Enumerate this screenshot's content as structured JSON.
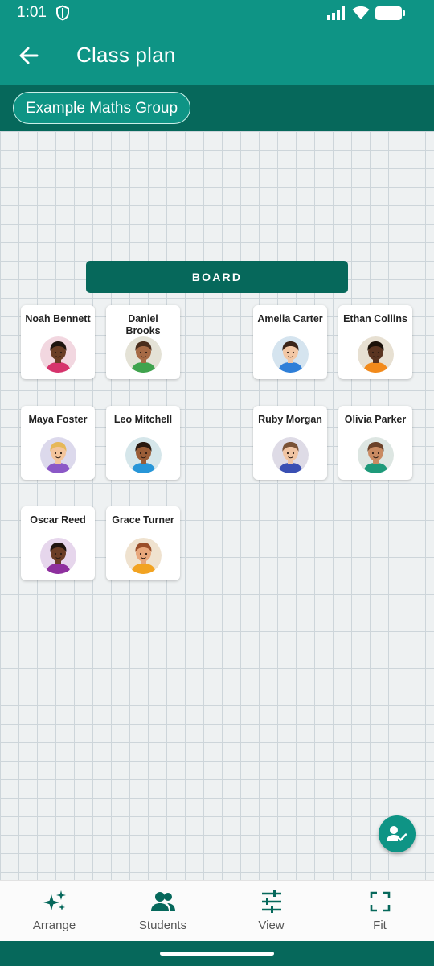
{
  "status": {
    "time": "1:01"
  },
  "header": {
    "title": "Class plan"
  },
  "group": {
    "chip_label": "Example Maths Group"
  },
  "board": {
    "label": "BOARD"
  },
  "students": [
    {
      "name": "Noah Bennett",
      "skin": "#6b3e26",
      "hair": "#1f1510",
      "shirt": "#d6336c",
      "bg": "#f2d7e0"
    },
    {
      "name": "Daniel Brooks",
      "skin": "#a66a45",
      "hair": "#4a2d1c",
      "shirt": "#3fa34d",
      "bg": "#e4e2d6"
    },
    {
      "name": "Amelia Carter",
      "skin": "#f2c7a5",
      "hair": "#3b2418",
      "shirt": "#2f7fd8",
      "bg": "#d5e4ef"
    },
    {
      "name": "Ethan Collins",
      "skin": "#5a3420",
      "hair": "#1b1109",
      "shirt": "#f28a1b",
      "bg": "#e7e0d2"
    },
    {
      "name": "Maya Foster",
      "skin": "#f3c59c",
      "hair": "#e6b858",
      "shirt": "#8b58c7",
      "bg": "#dcd9ec"
    },
    {
      "name": "Leo Mitchell",
      "skin": "#9a5d37",
      "hair": "#2a1a10",
      "shirt": "#2796d8",
      "bg": "#d5e6ea"
    },
    {
      "name": "Ruby Morgan",
      "skin": "#f0c4a3",
      "hair": "#7a5236",
      "shirt": "#3a4fb3",
      "bg": "#dedbe6"
    },
    {
      "name": "Olivia Parker",
      "skin": "#c98b62",
      "hair": "#6b4229",
      "shirt": "#1e9a7a",
      "bg": "#dde6e2"
    },
    {
      "name": "Oscar Reed",
      "skin": "#6b3e26",
      "hair": "#1f1510",
      "shirt": "#8e2f9e",
      "bg": "#e6d6ec"
    },
    {
      "name": "Grace Turner",
      "skin": "#e8a77c",
      "hair": "#9a4e2a",
      "shirt": "#f2a322",
      "bg": "#efe2cf"
    }
  ],
  "nav": {
    "arrange": "Arrange",
    "students": "Students",
    "view": "View",
    "fit": "Fit"
  },
  "colors": {
    "primary": "#0e9485",
    "primary_dark": "#06685b"
  },
  "icons": [
    "shield-icon",
    "signal-icon",
    "wifi-icon",
    "battery-icon",
    "back-arrow-icon",
    "sparkle-icon",
    "people-icon",
    "sliders-icon",
    "fullscreen-icon",
    "person-check-icon"
  ]
}
